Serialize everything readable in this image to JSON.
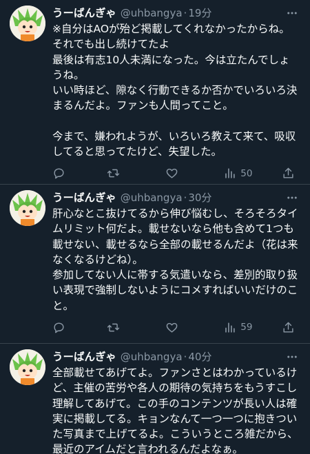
{
  "colors": {
    "background": "#15202b",
    "text": "#f7f9f9",
    "secondary": "#8b98a5",
    "divider": "#38444d"
  },
  "tweets": [
    {
      "name": "うーばんぎゃ",
      "handle": "@uhbangya",
      "separator": "·",
      "time": "19分",
      "lines": [
        "※自分はAOが殆ど掲載してくれなかったからね。",
        "それでも出し続けてたよ",
        "最後は有志10人未満になった。今は立たんでしょ",
        "うね。",
        "いい時ほど、隙なく行動できるか否かでいろいろ決",
        "まるんだよ。ファンも人間ってこと。",
        "",
        "今まで、嫌われようが、いろいろ教えて来て、吸収",
        "してると思ってたけど、失望した。"
      ],
      "views": "50",
      "icons": [
        "reply-icon",
        "retweet-icon",
        "like-icon",
        "views-icon",
        "share-icon",
        "more-icon"
      ]
    },
    {
      "name": "うーばんぎゃ",
      "handle": "@uhbangya",
      "separator": "·",
      "time": "30分",
      "lines": [
        "肝心なとこ抜けてるから伸び悩むし、そろそろタイ",
        "ムリミット何だよ。載せないなら他も含めて1つも",
        "載せない、載せるなら全部の載せるんだよ（花は来",
        "なくなるけどね）。",
        "参加してない人に帯する気遣いなら、差別的取り扱",
        "い表現で強制しないようにコメすればいいだけのこ",
        "と。"
      ],
      "views": "59",
      "icons": [
        "reply-icon",
        "retweet-icon",
        "like-icon",
        "views-icon",
        "share-icon",
        "more-icon"
      ]
    },
    {
      "name": "うーばんぎゃ",
      "handle": "@uhbangya",
      "separator": "·",
      "time": "40分",
      "lines": [
        "全部載せてあげてよ。ファンさとはわかっているけ",
        "ど、主催の苦労や各人の期待の気持ちをもうすこし",
        "理解してあげて。この手のコンテンツが長い人は確",
        "実に掲載してる。キョンなんて一つ一つに抱きつい",
        "た写真まで上げてるよ。こういうところ雑だから、",
        "最近のアイムだと言われるんだよなぁ。"
      ],
      "icons": [
        "more-icon"
      ]
    }
  ]
}
